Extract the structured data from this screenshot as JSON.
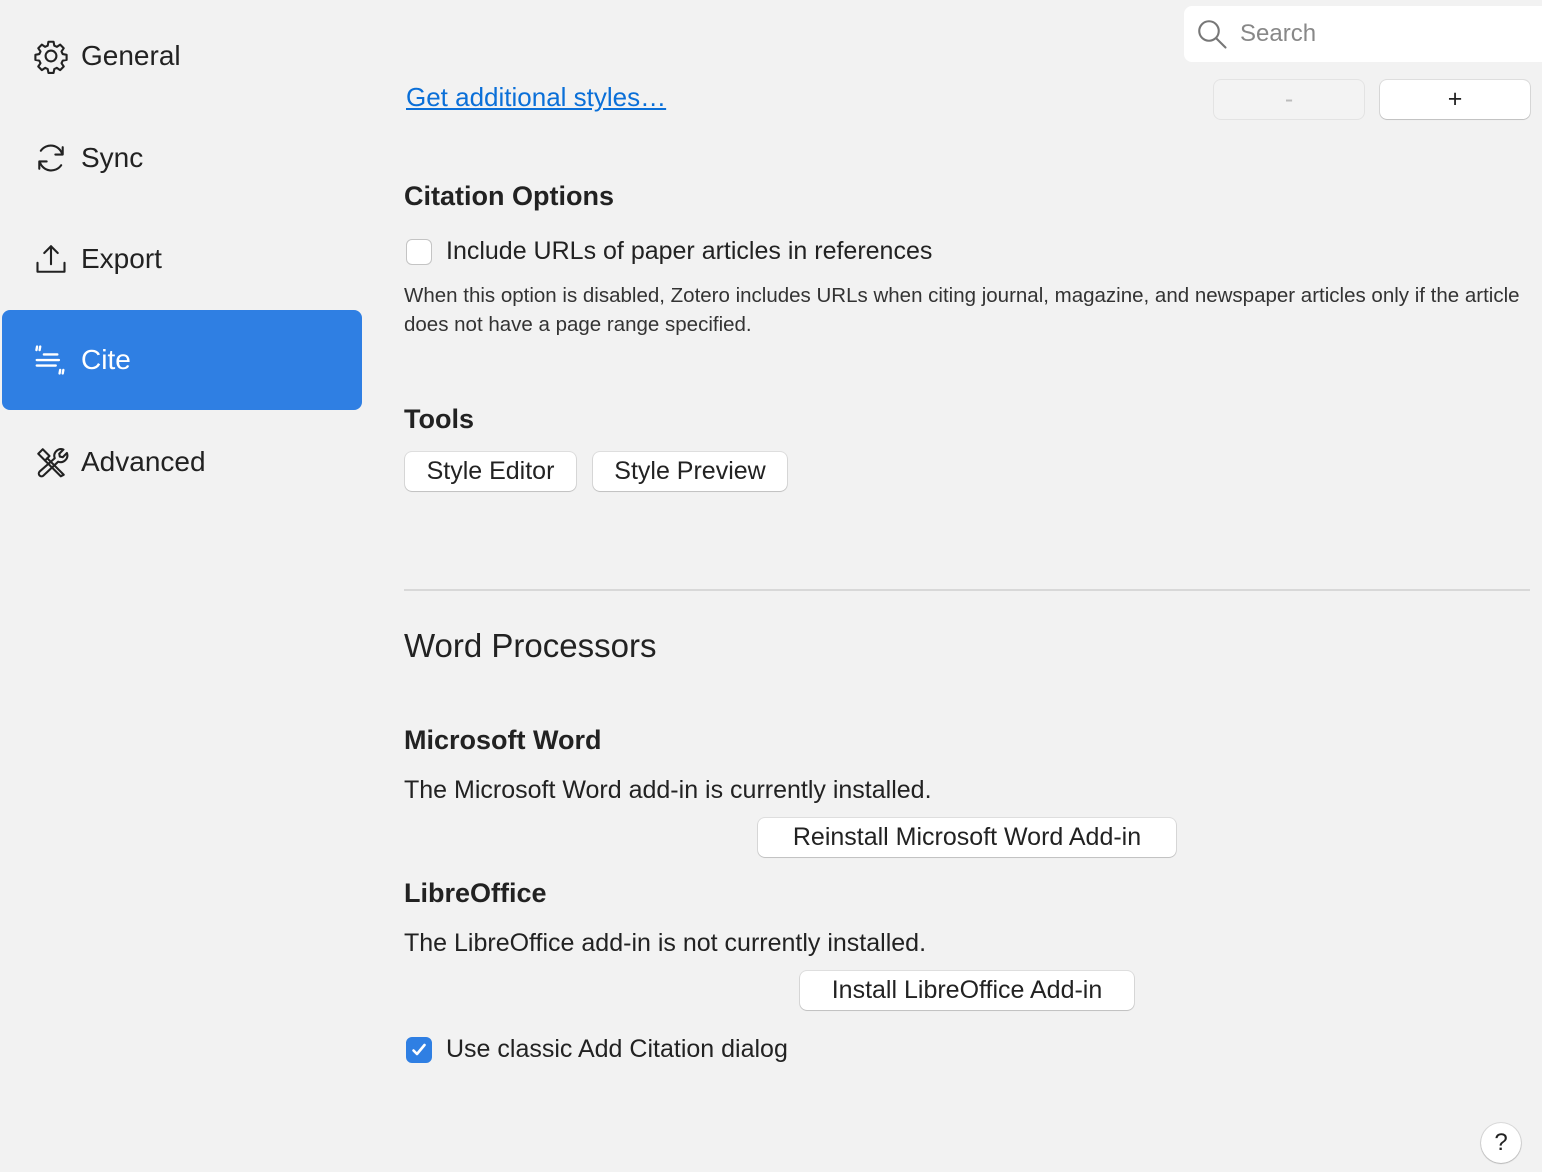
{
  "sidebar": {
    "items": [
      {
        "label": "General",
        "icon": "gear-icon"
      },
      {
        "label": "Sync",
        "icon": "sync-icon"
      },
      {
        "label": "Export",
        "icon": "export-icon"
      },
      {
        "label": "Cite",
        "icon": "cite-icon",
        "selected": true
      },
      {
        "label": "Advanced",
        "icon": "tools-icon"
      }
    ]
  },
  "search": {
    "placeholder": "Search",
    "value": ""
  },
  "styles": {
    "get_more_link": "Get additional styles…",
    "remove_label": "-",
    "add_label": "+"
  },
  "citation_options": {
    "heading": "Citation Options",
    "include_urls": {
      "label": "Include URLs of paper articles in references",
      "checked": false
    },
    "note": "When this option is disabled, Zotero includes URLs when citing journal, magazine, and newspaper articles only if the article does not have a page range specified."
  },
  "tools": {
    "heading": "Tools",
    "style_editor": "Style Editor",
    "style_preview": "Style Preview"
  },
  "word_processors": {
    "heading": "Word Processors",
    "word": {
      "heading": "Microsoft Word",
      "status": "The Microsoft Word add-in is currently installed.",
      "button": "Reinstall Microsoft Word Add-in"
    },
    "libreoffice": {
      "heading": "LibreOffice",
      "status": "The LibreOffice add-in is not currently installed.",
      "button": "Install LibreOffice Add-in"
    },
    "classic_dialog": {
      "label": "Use classic Add Citation dialog",
      "checked": true
    }
  },
  "help": {
    "label": "?"
  },
  "colors": {
    "accent": "#2f7fe3",
    "link": "#0a6fd8",
    "background": "#f2f2f2"
  }
}
